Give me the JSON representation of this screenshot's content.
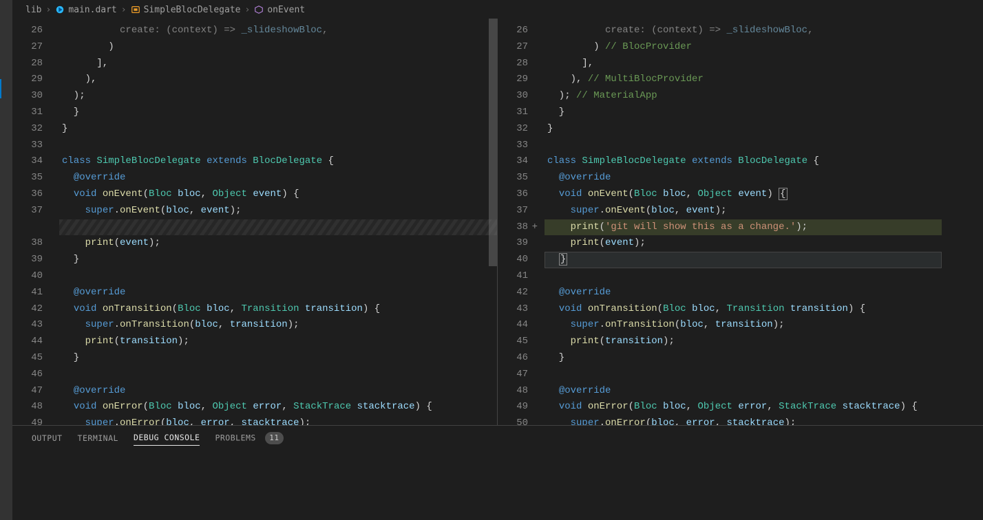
{
  "breadcrumbs": {
    "folder": "lib",
    "file": "main.dart",
    "class": "SimpleBlocDelegate",
    "method": "onEvent"
  },
  "left": {
    "lines": [
      {
        "n": "26",
        "t": [
          "          create: (context) => _slideshowBloc,"
        ],
        "kind": "cut"
      },
      {
        "n": "27",
        "t": [
          "        )"
        ]
      },
      {
        "n": "28",
        "t": [
          "      ],"
        ]
      },
      {
        "n": "29",
        "t": [
          "    ),"
        ]
      },
      {
        "n": "30",
        "t": [
          "  );"
        ]
      },
      {
        "n": "31",
        "t": [
          "  }"
        ]
      },
      {
        "n": "32",
        "t": [
          "}"
        ]
      },
      {
        "n": "33",
        "t": [
          ""
        ]
      },
      {
        "n": "34",
        "class": true
      },
      {
        "n": "35",
        "override": true
      },
      {
        "n": "36",
        "sig": "onEvent"
      },
      {
        "n": "37",
        "superOnEvent": true
      },
      {
        "n": "",
        "diffRemoved": true
      },
      {
        "n": "38",
        "printEvent": true
      },
      {
        "n": "39",
        "t": [
          "  }"
        ]
      },
      {
        "n": "40",
        "t": [
          ""
        ]
      },
      {
        "n": "41",
        "override": true
      },
      {
        "n": "42",
        "sig": "onTransition"
      },
      {
        "n": "43",
        "superOnTransition": true
      },
      {
        "n": "44",
        "printTransition": true
      },
      {
        "n": "45",
        "t": [
          "  }"
        ]
      },
      {
        "n": "46",
        "t": [
          ""
        ]
      },
      {
        "n": "47",
        "override": true
      },
      {
        "n": "48",
        "sig": "onError"
      },
      {
        "n": "49",
        "superOnError": true
      }
    ]
  },
  "right": {
    "lines": [
      {
        "n": "26",
        "t": [
          "          create: (context) => _slideshowBloc,"
        ],
        "kind": "cut"
      },
      {
        "n": "27",
        "t": [
          "        ) "
        ],
        "cmt": "// BlocProvider"
      },
      {
        "n": "28",
        "t": [
          "      ],"
        ]
      },
      {
        "n": "29",
        "t": [
          "    ), "
        ],
        "cmt": "// MultiBlocProvider"
      },
      {
        "n": "30",
        "t": [
          "  ); "
        ],
        "cmt": "// MaterialApp"
      },
      {
        "n": "31",
        "t": [
          "  }"
        ]
      },
      {
        "n": "32",
        "t": [
          "}"
        ]
      },
      {
        "n": "33",
        "t": [
          ""
        ]
      },
      {
        "n": "34",
        "class": true
      },
      {
        "n": "35",
        "override": true
      },
      {
        "n": "36",
        "sig": "onEvent",
        "boxBrace": true
      },
      {
        "n": "37",
        "superOnEvent": true
      },
      {
        "n": "38",
        "diffAdded": true,
        "plus": true,
        "addedPrint": true
      },
      {
        "n": "39",
        "printEvent": true
      },
      {
        "n": "40",
        "t": [
          "  }"
        ],
        "hl": true,
        "boxBraceClose": true
      },
      {
        "n": "41",
        "t": [
          ""
        ]
      },
      {
        "n": "42",
        "override": true
      },
      {
        "n": "43",
        "sig": "onTransition"
      },
      {
        "n": "44",
        "superOnTransition": true
      },
      {
        "n": "45",
        "printTransition": true
      },
      {
        "n": "46",
        "t": [
          "  }"
        ]
      },
      {
        "n": "47",
        "t": [
          ""
        ]
      },
      {
        "n": "48",
        "override": true
      },
      {
        "n": "49",
        "sig": "onError"
      },
      {
        "n": "50",
        "superOnError": true
      }
    ]
  },
  "strings": {
    "addedString": "'git will show this as a change.'"
  },
  "panel": {
    "output": "OUTPUT",
    "terminal": "TERMINAL",
    "debug": "DEBUG CONSOLE",
    "problems": "PROBLEMS",
    "problemsCount": "11"
  }
}
